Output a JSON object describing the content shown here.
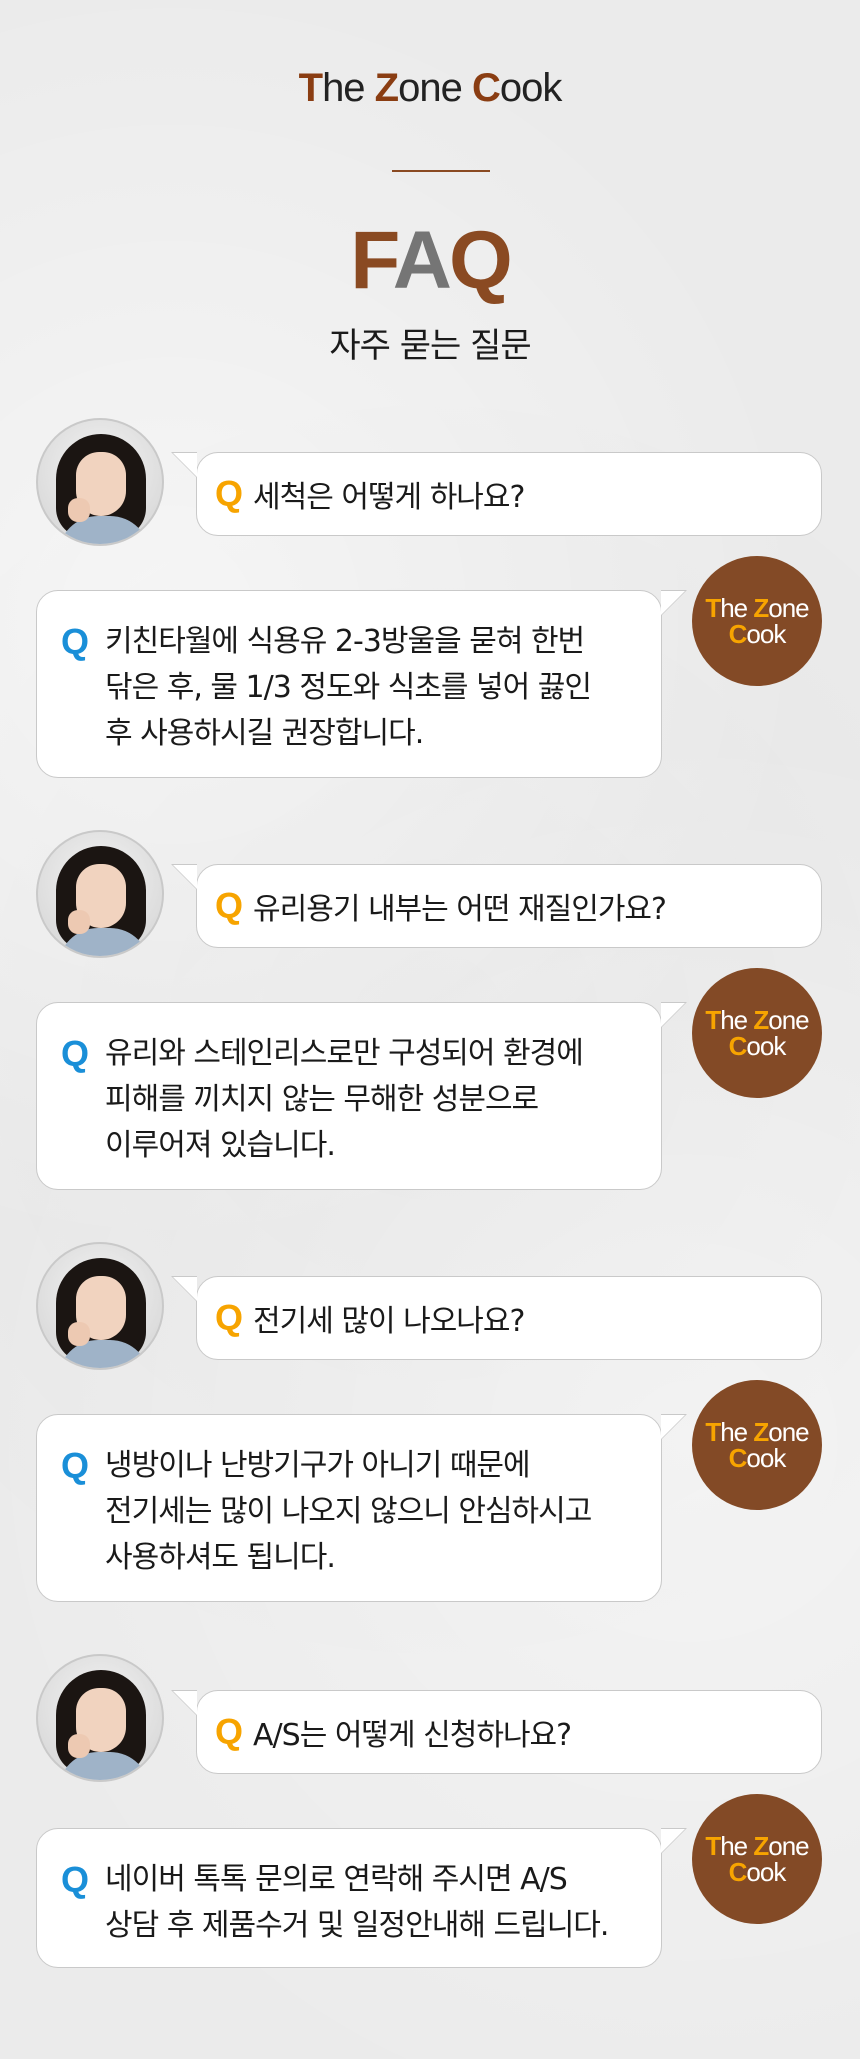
{
  "header": {
    "brand": {
      "part1_cap": "T",
      "part1_rest": "he ",
      "part2_cap": "Z",
      "part2_rest": "one ",
      "part3_cap": "C",
      "part3_rest": "ook"
    },
    "title": {
      "f": "F",
      "a": "A",
      "q": "Q"
    },
    "subtitle": "자주 묻는 질문"
  },
  "brand_badge": {
    "line1_cap": "T",
    "line1_rest1": "he ",
    "line1_cap2": "Z",
    "line1_rest2": "one",
    "line2_cap": "C",
    "line2_rest": "ook"
  },
  "faqs": [
    {
      "question": "세척은 어떻게 하나요?",
      "answer": "키친타월에 식용유 2-3방울을 묻혀 한번 닦은 후, 물 1/3 정도와 식초를 넣어 끓인 후 사용하시길 권장합니다.",
      "answer_lines": [
        "키친타월에 식용유 2-3방울을 묻혀 한번",
        "닦은 후, 물 1/3 정도와 식초를 넣어 끓인",
        "후 사용하시길 권장합니다."
      ]
    },
    {
      "question": "유리용기 내부는 어떤 재질인가요?",
      "answer_lines": [
        "유리와 스테인리스로만 구성되어 환경에",
        "피해를 끼치지 않는 무해한 성분으로",
        "이루어져 있습니다."
      ]
    },
    {
      "question": "전기세 많이 나오나요?",
      "answer_lines": [
        "냉방이나 난방기구가 아니기 때문에",
        "전기세는 많이 나오지 않으니 안심하시고",
        "사용하셔도 됩니다."
      ]
    },
    {
      "question": "A/S는 어떻게 신청하나요?",
      "answer_lines": [
        "네이버 톡톡 문의로 연락해 주시면 A/S",
        "상담 후 제품수거 및 일정안내해 드립니다."
      ]
    }
  ],
  "q_mark": "Q",
  "colors": {
    "brand_brown": "#834a26",
    "accent_orange": "#f7a400",
    "accent_blue": "#1a8fd8",
    "title_gray": "#757575"
  }
}
